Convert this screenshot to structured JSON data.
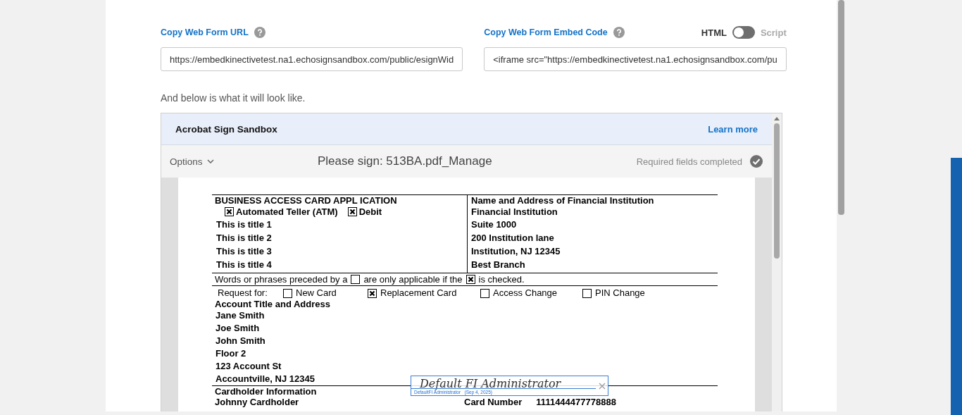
{
  "url_field": {
    "label": "Copy Web Form URL",
    "value": "https://embedkinectivetest.na1.echosignsandbox.com/public/esignWid"
  },
  "embed_field": {
    "label": "Copy Web Form Embed Code",
    "value": "<iframe src=\"https://embedkinectivetest.na1.echosignsandbox.com/pu"
  },
  "format_toggle": {
    "left": "HTML",
    "right": "Script",
    "on": false
  },
  "preview_note": "And below is what it will look like.",
  "preview": {
    "brand": "Acrobat Sign Sandbox",
    "learn_more": "Learn more",
    "options": "Options",
    "title": "Please sign: 513BA.pdf_Manage",
    "status": "Required fields completed"
  },
  "document": {
    "heading": "BUSINESS ACCESS CARD APPL ICATION",
    "card_types": [
      {
        "label": "Automated Teller (ATM)",
        "checked": true
      },
      {
        "label": "Debit",
        "checked": true
      }
    ],
    "titles": [
      "This is title 1",
      "This is title 2",
      "This is title 3",
      "This is title 4"
    ],
    "institution_heading": "Name and Address of Financial Institution",
    "institution_lines": [
      "Financial Institution",
      "Suite 1000",
      "200 Institution lane",
      "Institution, NJ 12345",
      "Best Branch"
    ],
    "note": [
      {
        "kind": "text",
        "text": "Words or phrases preceded by a"
      },
      {
        "kind": "box",
        "checked": false
      },
      {
        "kind": "text",
        "text": "are only applicable if the"
      },
      {
        "kind": "box",
        "checked": true
      },
      {
        "kind": "text",
        "text": "is checked."
      }
    ],
    "request_label": "Request for:",
    "requests": [
      {
        "label": "New Card",
        "checked": false
      },
      {
        "label": "Replacement Card",
        "checked": true
      },
      {
        "label": "Access Change",
        "checked": false
      },
      {
        "label": "PIN Change",
        "checked": false
      }
    ],
    "account_heading": "Account Title and Address",
    "account_lines": [
      "Jane Smith",
      "Joe Smith",
      "John Smith",
      "Floor 2",
      "123 Account St",
      "Accountville, NJ 12345"
    ],
    "cardholder_heading": "Cardholder Information",
    "cardholder_name": "Johnny Cardholder",
    "card_number_label": "Card Number",
    "card_number": "1111444477778888"
  },
  "signature": {
    "name": "Default FI Administrator",
    "caption": "DefaultFI Administrator",
    "date": "(Sep 4, 2025)"
  }
}
